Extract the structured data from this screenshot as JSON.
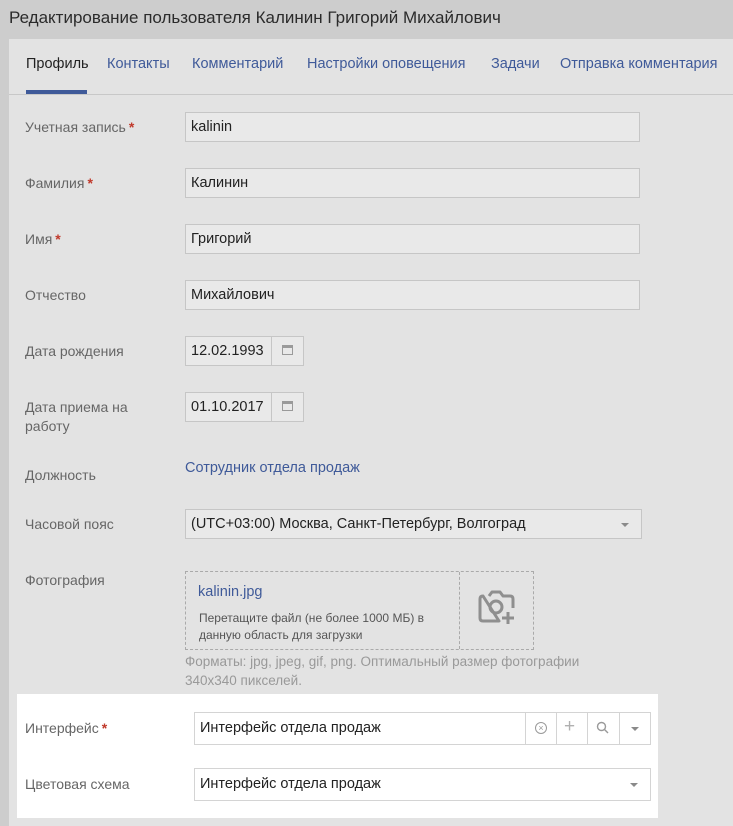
{
  "page": {
    "title": "Редактирование пользователя Калинин Григорий Михайлович"
  },
  "tabs": [
    "Профиль",
    "Контакты",
    "Комментарий",
    "Настройки оповещения",
    "Задачи",
    "Отправка комментария"
  ],
  "form": {
    "account": {
      "label": "Учетная запись",
      "required": "*",
      "value": "kalinin"
    },
    "last_name": {
      "label": "Фамилия",
      "required": "*",
      "value": "Калинин"
    },
    "first_name": {
      "label": "Имя",
      "required": "*",
      "value": "Григорий"
    },
    "middle_name": {
      "label": "Отчество",
      "value": "Михайлович"
    },
    "birth_date": {
      "label": "Дата рождения",
      "value": "12.02.1993"
    },
    "hire_date": {
      "label_line1": "Дата приема на",
      "label_line2": "работу",
      "value": "01.10.2017"
    },
    "position": {
      "label": "Должность",
      "value": "Сотрудник отдела продаж"
    },
    "timezone": {
      "label": "Часовой пояс",
      "value": "(UTC+03:00) Москва, Санкт-Петербург, Волгоград"
    },
    "photo": {
      "label": "Фотография",
      "file_name": "kalinin.jpg",
      "drop_hint_line1": "Перетащите файл (не более 1000 МБ) в",
      "drop_hint_line2": "данную область для загрузки",
      "formats_line1": "Форматы: jpg, jpeg, gif, png. Оптимальный размер фотографии",
      "formats_line2": "340x340 пикселей."
    },
    "interface": {
      "label": "Интерфейс",
      "required": "*",
      "value": "Интерфейс отдела продаж"
    },
    "color_scheme": {
      "label": "Цветовая схема",
      "value": "Интерфейс отдела продаж"
    }
  },
  "icons": {
    "calendar": "calendar-icon",
    "camera_add": "camera-add-icon",
    "clear": "clear-circle-icon",
    "add": "plus-icon",
    "search": "search-icon",
    "dropdown": "chevron-down-icon"
  },
  "colors": {
    "accent": "#3f5a99",
    "required": "#c0392b"
  }
}
